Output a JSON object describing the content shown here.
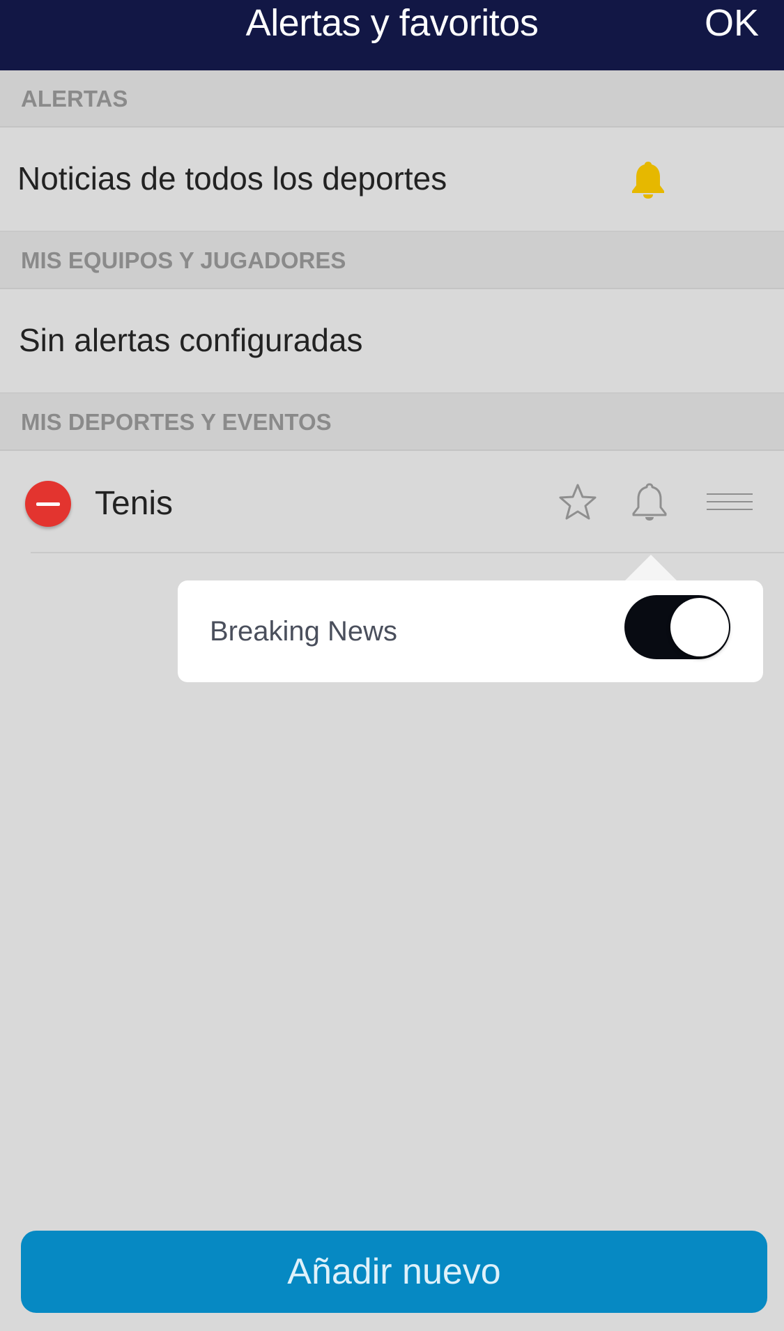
{
  "header": {
    "title": "Alertas y favoritos",
    "ok_label": "OK",
    "background_color": "#121745"
  },
  "sections": {
    "alerts": {
      "title": "ALERTAS",
      "row_label": "Noticias de todos los deportes",
      "row_icon": "bell-filled-icon",
      "icon_color": "#e6b800"
    },
    "teams_players": {
      "title": "MIS EQUIPOS Y JUGADORES",
      "empty_label": "Sin alertas configuradas"
    },
    "sports_events": {
      "title": "MIS DEPORTES Y EVENTOS",
      "items": [
        {
          "label": "Tenis",
          "icons": [
            "remove-icon",
            "star-icon",
            "bell-icon",
            "drag-handle-icon"
          ]
        }
      ]
    }
  },
  "popover": {
    "label": "Breaking News",
    "toggle_on": true
  },
  "footer": {
    "add_label": "Añadir nuevo",
    "button_color": "#0689c3"
  }
}
